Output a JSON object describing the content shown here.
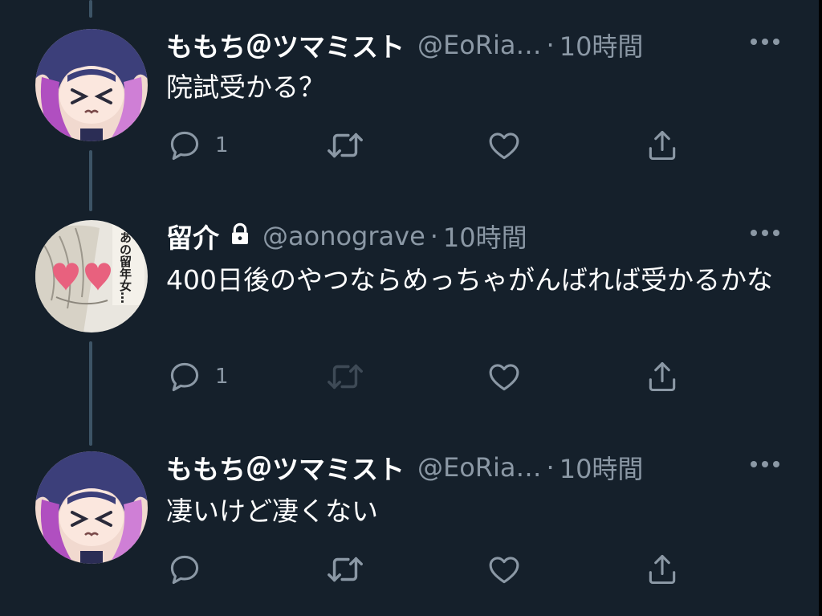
{
  "colors": {
    "background": "#15202b",
    "text_primary": "#ffffff",
    "text_secondary": "#8b98a5",
    "thread_line": "#3d5466",
    "retweet_disabled": "#3e4a56"
  },
  "icons": {
    "reply": "reply-icon",
    "retweet": "retweet-icon",
    "like": "heart-icon",
    "share": "share-icon",
    "more": "more-options-icon",
    "lock": "lock-icon"
  },
  "tweets": [
    {
      "display_name": "ももち＠ツマミスト",
      "handle": "@EoRia…",
      "separator": "·",
      "time": "10時間",
      "text": "院試受かる？",
      "reply_count": "1",
      "protected": false,
      "retweet_enabled": true
    },
    {
      "display_name": "留介",
      "handle": "@aonograve",
      "separator": "·",
      "time": "10時間",
      "text": "400日後のやつならめっちゃがんばれば受かるかな",
      "reply_count": "1",
      "protected": true,
      "retweet_enabled": false,
      "avatar_manga_text": "あの留年女…"
    },
    {
      "display_name": "ももち＠ツマミスト",
      "handle": "@EoRia…",
      "separator": "·",
      "time": "10時間",
      "text": "凄いけど凄くない",
      "reply_count": "",
      "protected": false,
      "retweet_enabled": true
    }
  ]
}
